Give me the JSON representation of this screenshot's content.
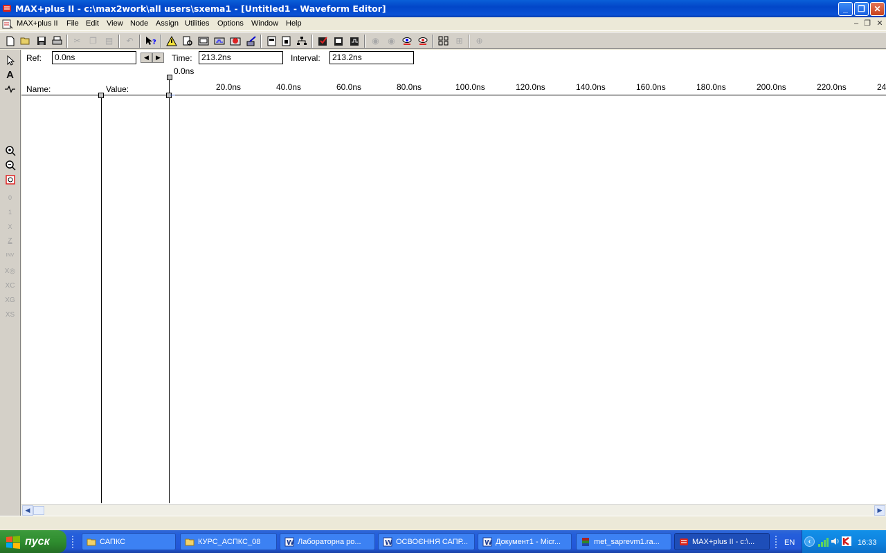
{
  "window": {
    "title": "MAX+plus II - c:\\max2work\\all users\\sxema1 - [Untitled1 - Waveform Editor]",
    "minimize_label": "_",
    "restore_label": "❐",
    "close_label": "✕"
  },
  "menu": [
    "MAX+plus II",
    "File",
    "Edit",
    "View",
    "Node",
    "Assign",
    "Utilities",
    "Options",
    "Window",
    "Help"
  ],
  "mdi_controls": {
    "minimize": "–",
    "restore": "❐",
    "close": "✕"
  },
  "toolbar_icons": [
    "new-icon",
    "open-icon",
    "save-icon",
    "print-icon",
    "cut-icon",
    "copy-icon",
    "paste-icon",
    "undo-icon",
    "help-cursor-icon",
    "hierarchy-up-icon",
    "open-file-icon",
    "compiler-icon",
    "simulator-icon",
    "timing-analyzer-icon",
    "programmer-icon",
    "project-icon",
    "floorplan-icon",
    "hierarchy-icon",
    "save-check-icon",
    "save-compile-icon",
    "save-simulate-icon",
    "find-node-icon",
    "find-next-icon",
    "find-source-icon",
    "find-error-icon",
    "view-grid-icon",
    "view-ungrid-icon",
    "zoom-fit-icon"
  ],
  "palette_icons": [
    "selection-tool-icon",
    "text-tool-icon",
    "waveform-edit-icon",
    "zoom-in-icon",
    "zoom-out-icon",
    "fit-in-window-icon",
    "low-0-icon",
    "high-1-icon",
    "dont-care-x-icon",
    "high-impedance-z-icon",
    "invert-icon",
    "overwrite-clock-icon",
    "overwrite-count-icon",
    "overwrite-group-icon",
    "overwrite-sequence-icon"
  ],
  "editor": {
    "ref_label": "Ref:",
    "ref_value": "0.0ns",
    "time_label": "Time:",
    "time_value": "213.2ns",
    "interval_label": "Interval:",
    "interval_value": "213.2ns",
    "cursor_label": "0.0ns",
    "name_header": "Name:",
    "value_header": "Value:",
    "ticks": [
      "20.0ns",
      "40.0ns",
      "60.0ns",
      "80.0ns",
      "100.0ns",
      "120.0ns",
      "140.0ns",
      "160.0ns",
      "180.0ns",
      "200.0ns",
      "220.0ns",
      "24"
    ]
  },
  "taskbar": {
    "start_label": "пуск",
    "tasks": [
      {
        "label": "САПКС",
        "icon": "folder-icon"
      },
      {
        "label": "КУРС_АСПКС_08",
        "icon": "folder-icon"
      },
      {
        "label": "Лабораторна ро...",
        "icon": "word-icon"
      },
      {
        "label": "ОСВОЄННЯ САПР...",
        "icon": "word-icon"
      },
      {
        "label": "Документ1 - Micr...",
        "icon": "word-icon"
      },
      {
        "label": "met_saprevm1.ra...",
        "icon": "winrar-icon"
      },
      {
        "label": "MAX+plus II - c:\\...",
        "icon": "maxplus-icon"
      }
    ],
    "language": "EN",
    "clock": "16:33"
  }
}
